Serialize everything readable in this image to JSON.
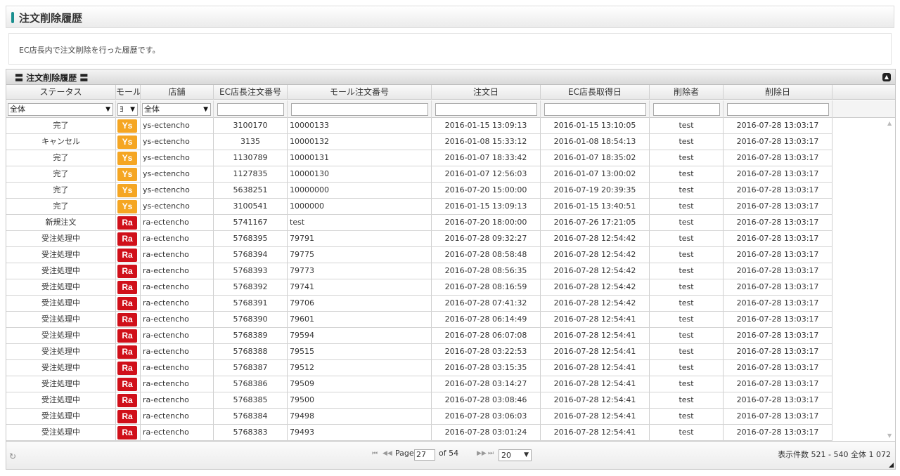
{
  "page": {
    "title": "注文削除履歴",
    "description": "EC店長内で注文削除を行った履歴です。"
  },
  "grid": {
    "caption": "〓 注文削除履歴 〓",
    "columns": [
      {
        "key": "status",
        "label": "ステータス"
      },
      {
        "key": "mall",
        "label": "モール"
      },
      {
        "key": "shop",
        "label": "店舗"
      },
      {
        "key": "ec_no",
        "label": "EC店長注文番号"
      },
      {
        "key": "mall_no",
        "label": "モール注文番号"
      },
      {
        "key": "order_date",
        "label": "注文日"
      },
      {
        "key": "acquired_date",
        "label": "EC店長取得日"
      },
      {
        "key": "deleted_by",
        "label": "削除者"
      },
      {
        "key": "deleted_date",
        "label": "削除日"
      }
    ],
    "filters": {
      "status": "全体",
      "mall": "ﾖ",
      "shop": "全体",
      "ec_no": "",
      "mall_no": "",
      "order_date": "",
      "acquired_date": "",
      "deleted_by": "",
      "deleted_date": ""
    },
    "mall_colors": {
      "Ys": "#f5a623",
      "Ra": "#d0101a"
    },
    "rows": [
      {
        "status": "完了",
        "mall": "Ys",
        "shop": "ys-ectencho",
        "ec_no": "3100170",
        "mall_no": "10000133",
        "order_date": "2016-01-15 13:09:13",
        "acquired_date": "2016-01-15 13:10:05",
        "deleted_by": "test",
        "deleted_date": "2016-07-28 13:03:17"
      },
      {
        "status": "キャンセル",
        "mall": "Ys",
        "shop": "ys-ectencho",
        "ec_no": "3135",
        "mall_no": "10000132",
        "order_date": "2016-01-08 15:33:12",
        "acquired_date": "2016-01-08 18:54:13",
        "deleted_by": "test",
        "deleted_date": "2016-07-28 13:03:17"
      },
      {
        "status": "完了",
        "mall": "Ys",
        "shop": "ys-ectencho",
        "ec_no": "1130789",
        "mall_no": "10000131",
        "order_date": "2016-01-07 18:33:42",
        "acquired_date": "2016-01-07 18:35:02",
        "deleted_by": "test",
        "deleted_date": "2016-07-28 13:03:17"
      },
      {
        "status": "完了",
        "mall": "Ys",
        "shop": "ys-ectencho",
        "ec_no": "1127835",
        "mall_no": "10000130",
        "order_date": "2016-01-07 12:56:03",
        "acquired_date": "2016-01-07 13:00:02",
        "deleted_by": "test",
        "deleted_date": "2016-07-28 13:03:17"
      },
      {
        "status": "完了",
        "mall": "Ys",
        "shop": "ys-ectencho",
        "ec_no": "5638251",
        "mall_no": "10000000",
        "order_date": "2016-07-20 15:00:00",
        "acquired_date": "2016-07-19 20:39:35",
        "deleted_by": "test",
        "deleted_date": "2016-07-28 13:03:17"
      },
      {
        "status": "完了",
        "mall": "Ys",
        "shop": "ys-ectencho",
        "ec_no": "3100541",
        "mall_no": "1000000",
        "order_date": "2016-01-15 13:09:13",
        "acquired_date": "2016-01-15 13:40:51",
        "deleted_by": "test",
        "deleted_date": "2016-07-28 13:03:17"
      },
      {
        "status": "新規注文",
        "mall": "Ra",
        "shop": "ra-ectencho",
        "ec_no": "5741167",
        "mall_no": "test",
        "order_date": "2016-07-20 18:00:00",
        "acquired_date": "2016-07-26 17:21:05",
        "deleted_by": "test",
        "deleted_date": "2016-07-28 13:03:17"
      },
      {
        "status": "受注処理中",
        "mall": "Ra",
        "shop": "ra-ectencho",
        "ec_no": "5768395",
        "mall_no": "79791",
        "order_date": "2016-07-28 09:32:27",
        "acquired_date": "2016-07-28 12:54:42",
        "deleted_by": "test",
        "deleted_date": "2016-07-28 13:03:17"
      },
      {
        "status": "受注処理中",
        "mall": "Ra",
        "shop": "ra-ectencho",
        "ec_no": "5768394",
        "mall_no": "79775",
        "order_date": "2016-07-28 08:58:48",
        "acquired_date": "2016-07-28 12:54:42",
        "deleted_by": "test",
        "deleted_date": "2016-07-28 13:03:17"
      },
      {
        "status": "受注処理中",
        "mall": "Ra",
        "shop": "ra-ectencho",
        "ec_no": "5768393",
        "mall_no": "79773",
        "order_date": "2016-07-28 08:56:35",
        "acquired_date": "2016-07-28 12:54:42",
        "deleted_by": "test",
        "deleted_date": "2016-07-28 13:03:17"
      },
      {
        "status": "受注処理中",
        "mall": "Ra",
        "shop": "ra-ectencho",
        "ec_no": "5768392",
        "mall_no": "79741",
        "order_date": "2016-07-28 08:16:59",
        "acquired_date": "2016-07-28 12:54:42",
        "deleted_by": "test",
        "deleted_date": "2016-07-28 13:03:17"
      },
      {
        "status": "受注処理中",
        "mall": "Ra",
        "shop": "ra-ectencho",
        "ec_no": "5768391",
        "mall_no": "79706",
        "order_date": "2016-07-28 07:41:32",
        "acquired_date": "2016-07-28 12:54:42",
        "deleted_by": "test",
        "deleted_date": "2016-07-28 13:03:17"
      },
      {
        "status": "受注処理中",
        "mall": "Ra",
        "shop": "ra-ectencho",
        "ec_no": "5768390",
        "mall_no": "79601",
        "order_date": "2016-07-28 06:14:49",
        "acquired_date": "2016-07-28 12:54:41",
        "deleted_by": "test",
        "deleted_date": "2016-07-28 13:03:17"
      },
      {
        "status": "受注処理中",
        "mall": "Ra",
        "shop": "ra-ectencho",
        "ec_no": "5768389",
        "mall_no": "79594",
        "order_date": "2016-07-28 06:07:08",
        "acquired_date": "2016-07-28 12:54:41",
        "deleted_by": "test",
        "deleted_date": "2016-07-28 13:03:17"
      },
      {
        "status": "受注処理中",
        "mall": "Ra",
        "shop": "ra-ectencho",
        "ec_no": "5768388",
        "mall_no": "79515",
        "order_date": "2016-07-28 03:22:53",
        "acquired_date": "2016-07-28 12:54:41",
        "deleted_by": "test",
        "deleted_date": "2016-07-28 13:03:17"
      },
      {
        "status": "受注処理中",
        "mall": "Ra",
        "shop": "ra-ectencho",
        "ec_no": "5768387",
        "mall_no": "79512",
        "order_date": "2016-07-28 03:15:35",
        "acquired_date": "2016-07-28 12:54:41",
        "deleted_by": "test",
        "deleted_date": "2016-07-28 13:03:17"
      },
      {
        "status": "受注処理中",
        "mall": "Ra",
        "shop": "ra-ectencho",
        "ec_no": "5768386",
        "mall_no": "79509",
        "order_date": "2016-07-28 03:14:27",
        "acquired_date": "2016-07-28 12:54:41",
        "deleted_by": "test",
        "deleted_date": "2016-07-28 13:03:17"
      },
      {
        "status": "受注処理中",
        "mall": "Ra",
        "shop": "ra-ectencho",
        "ec_no": "5768385",
        "mall_no": "79500",
        "order_date": "2016-07-28 03:08:46",
        "acquired_date": "2016-07-28 12:54:41",
        "deleted_by": "test",
        "deleted_date": "2016-07-28 13:03:17"
      },
      {
        "status": "受注処理中",
        "mall": "Ra",
        "shop": "ra-ectencho",
        "ec_no": "5768384",
        "mall_no": "79498",
        "order_date": "2016-07-28 03:06:03",
        "acquired_date": "2016-07-28 12:54:41",
        "deleted_by": "test",
        "deleted_date": "2016-07-28 13:03:17"
      },
      {
        "status": "受注処理中",
        "mall": "Ra",
        "shop": "ra-ectencho",
        "ec_no": "5768383",
        "mall_no": "79493",
        "order_date": "2016-07-28 03:01:24",
        "acquired_date": "2016-07-28 12:54:41",
        "deleted_by": "test",
        "deleted_date": "2016-07-28 13:03:17"
      }
    ]
  },
  "pager": {
    "first_icon": "first-page-icon",
    "prev_icon": "prev-page-icon",
    "page_label": "Page",
    "current_page": "27",
    "of_label": "of 54",
    "next_icon": "next-page-icon",
    "last_icon": "last-page-icon",
    "page_size": "20",
    "summary": "表示件数 521 - 540 全体 1 072"
  }
}
